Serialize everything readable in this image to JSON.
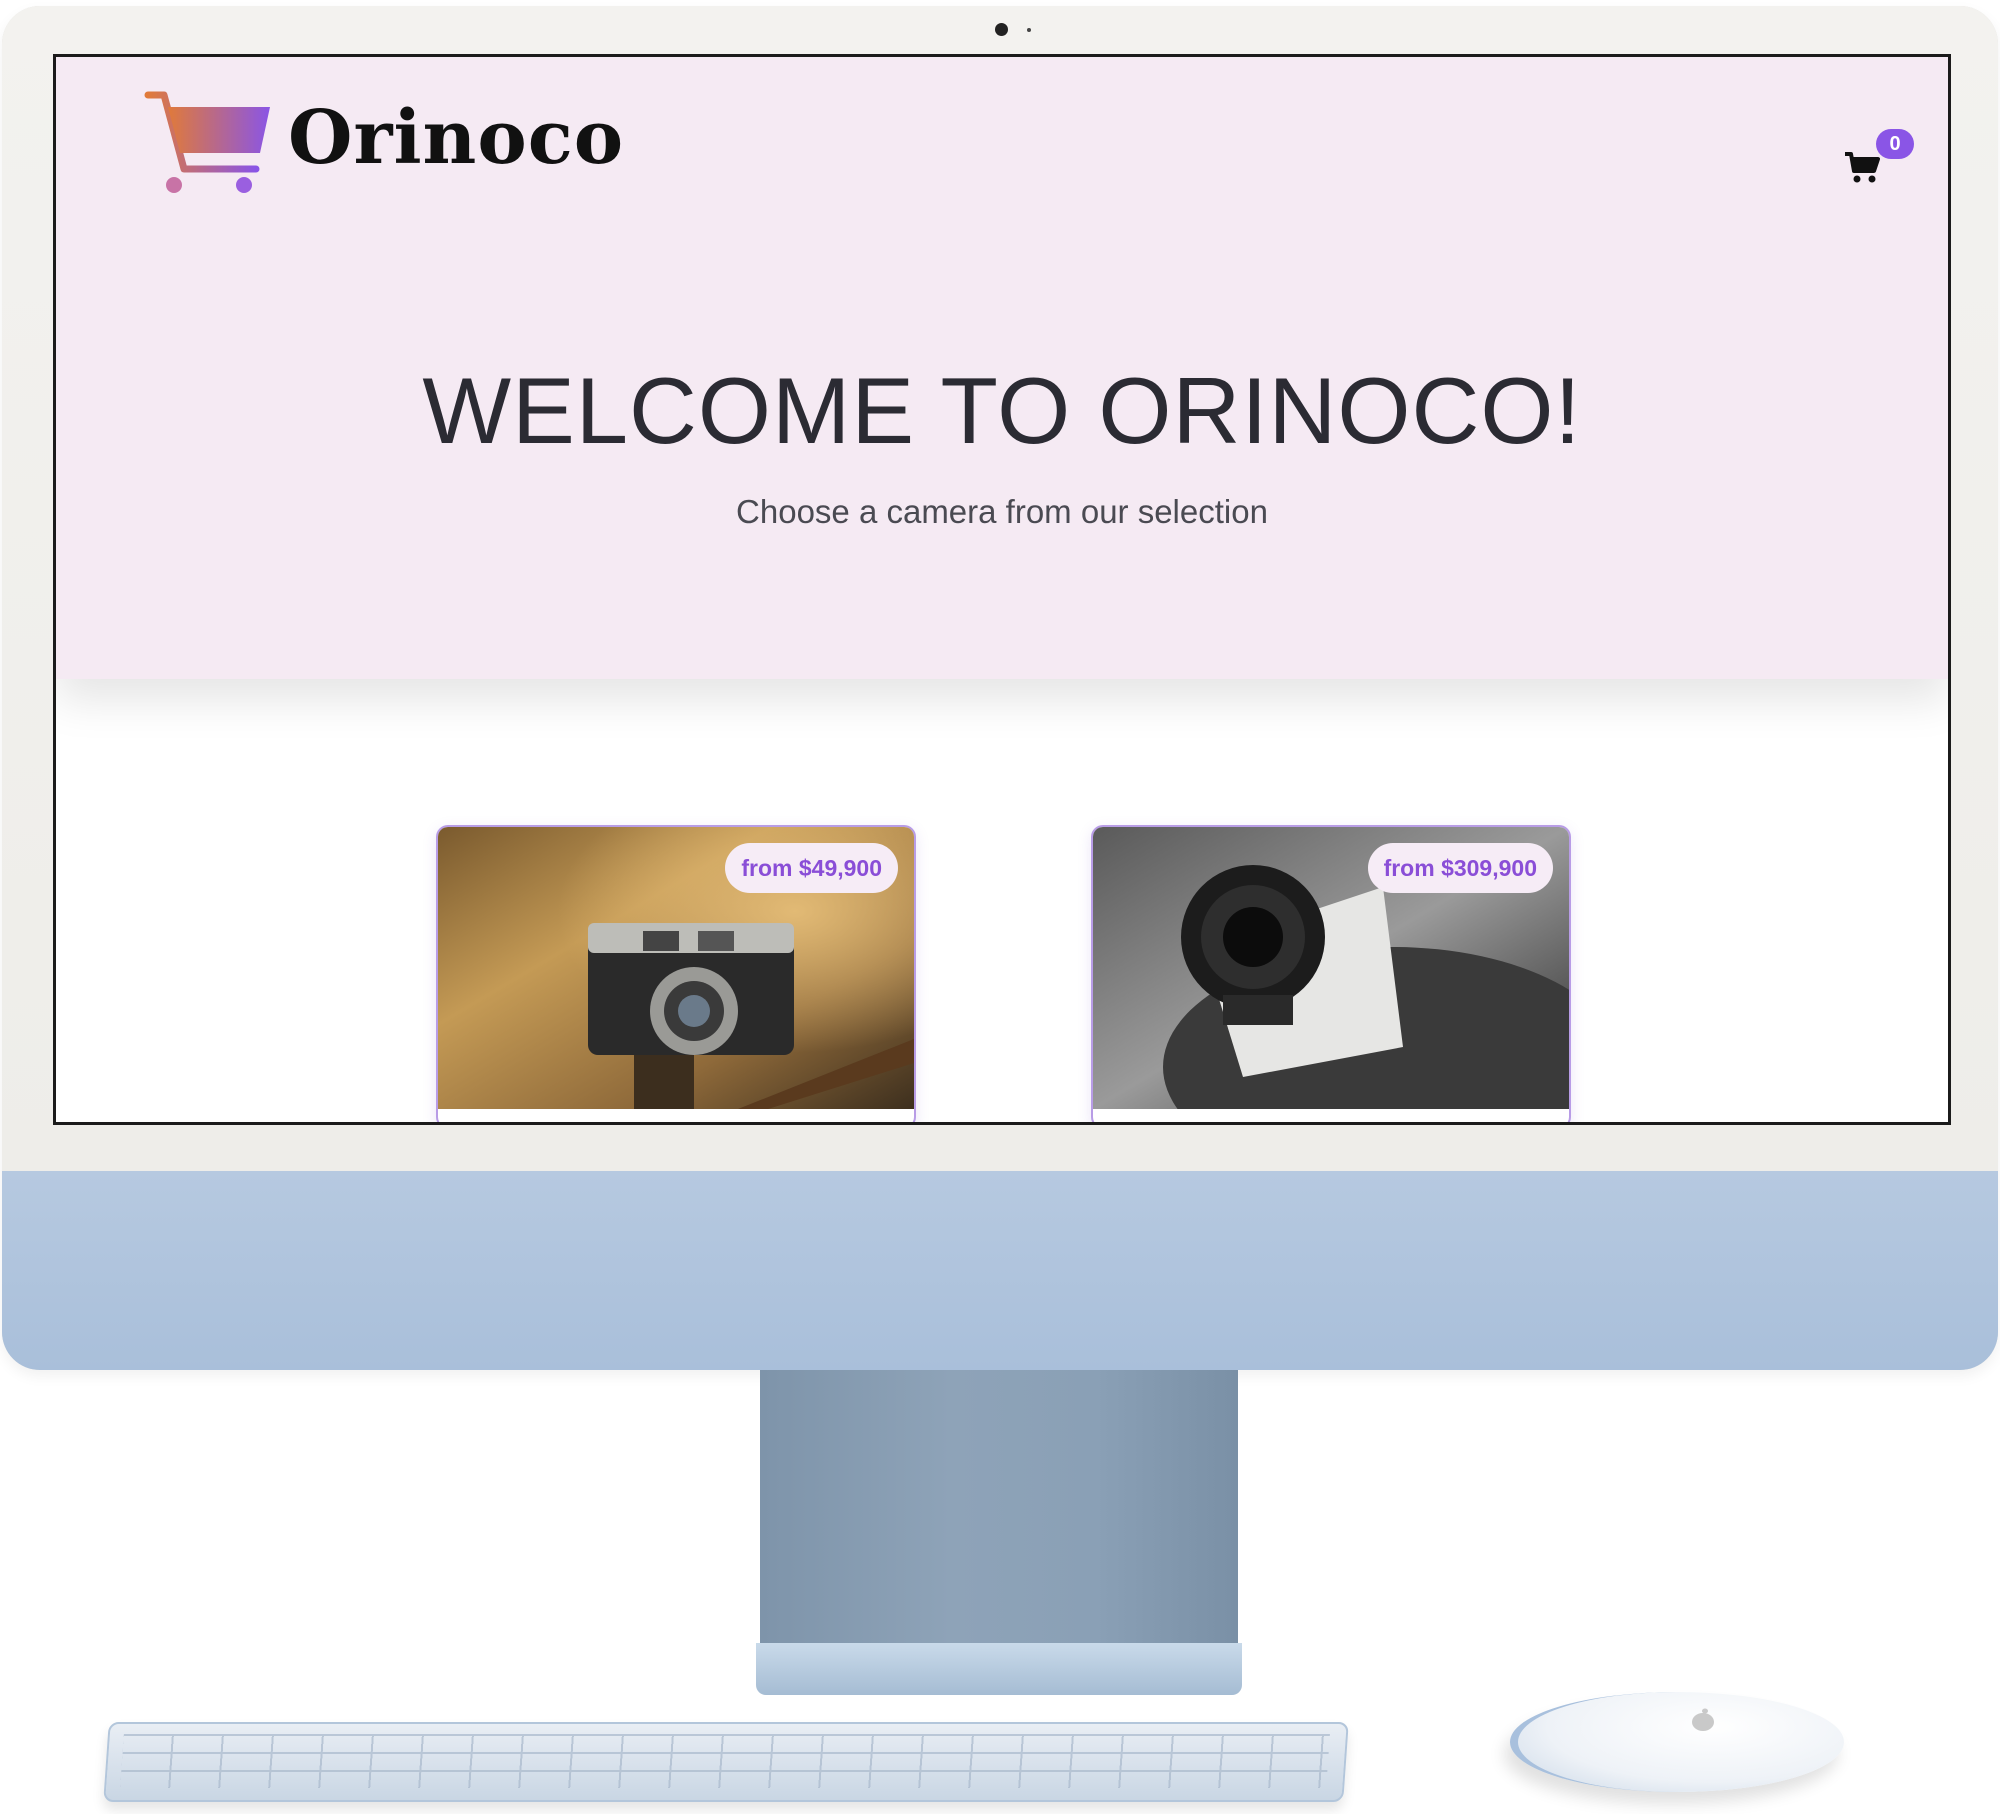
{
  "header": {
    "brand_name": "Orinoco",
    "cart_count": "0"
  },
  "hero": {
    "title": "WELCOME TO ORINOCO!",
    "subtitle": "Choose a camera from our selection"
  },
  "products": [
    {
      "price_label": "from $49,900"
    },
    {
      "price_label": "from $309,900"
    }
  ],
  "colors": {
    "hero_bg": "#f5eaf3",
    "accent": "#8a55e6",
    "price_text": "#8a4ed7",
    "card_border": "#b89ce6"
  },
  "icons": {
    "logo": "shopping-cart-gradient-icon",
    "cart": "shopping-cart-icon"
  }
}
